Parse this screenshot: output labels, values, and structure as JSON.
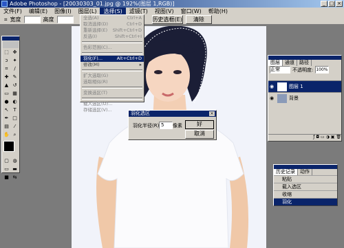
{
  "window": {
    "title": "Adobe Photoshop - [20030303_01.jpg @ 192%(图层 1,RGB)]",
    "controls": [
      "_",
      "□",
      "×"
    ]
  },
  "menubar": [
    "文件(F)",
    "编辑(E)",
    "图像(I)",
    "图层(L)",
    "选择(S)",
    "滤镜(T)",
    "视图(V)",
    "窗口(W)",
    "帮助(H)"
  ],
  "optionsbar": {
    "feather_label": "羽化:",
    "width_label": "宽度",
    "height_label": "高度",
    "history_button": "历史选框(E)",
    "clear_button": "清除"
  },
  "select_menu": {
    "items": [
      {
        "label": "全选(A)",
        "shortcut": "Ctrl+A"
      },
      {
        "label": "取消选择(D)",
        "shortcut": "Ctrl+D"
      },
      {
        "label": "重新选择(E)",
        "shortcut": "Shift+Ctrl+D"
      },
      {
        "label": "反选(I)",
        "shortcut": "Shift+Ctrl+I"
      },
      {
        "label": "色彩范围(C)...",
        "shortcut": ""
      },
      {
        "label": "羽化(F)...",
        "shortcut": "Alt+Ctrl+D"
      },
      {
        "label": "修改(M)",
        "shortcut": "▸"
      },
      {
        "label": "扩大选取(G)",
        "shortcut": ""
      },
      {
        "label": "选取相似(R)",
        "shortcut": ""
      },
      {
        "label": "变换选区(T)",
        "shortcut": ""
      },
      {
        "label": "载入选区(O)...",
        "shortcut": ""
      },
      {
        "label": "存储选区(V)...",
        "shortcut": ""
      }
    ]
  },
  "feather_dialog": {
    "title": "羽化选区",
    "label": "羽化半径(R):",
    "value": "5",
    "unit": "像素",
    "ok": "好",
    "cancel": "取消"
  },
  "layers_panel": {
    "tabs": [
      "图层",
      "通道",
      "路径"
    ],
    "mode": "正常",
    "opacity_label": "不透明度:",
    "opacity_value": "100%",
    "layers": [
      {
        "name": "图层 1",
        "selected": true
      },
      {
        "name": "背景",
        "selected": false
      }
    ]
  },
  "history_panel": {
    "tabs": [
      "历史记录",
      "动作"
    ],
    "items": [
      {
        "label": "粘贴"
      },
      {
        "label": "载入选区"
      },
      {
        "label": "收缩"
      },
      {
        "label": "羽化"
      }
    ]
  },
  "colors": {
    "titlebar": "#0a246a",
    "chrome": "#d4d0c8",
    "workspace": "#7b7b7b"
  }
}
